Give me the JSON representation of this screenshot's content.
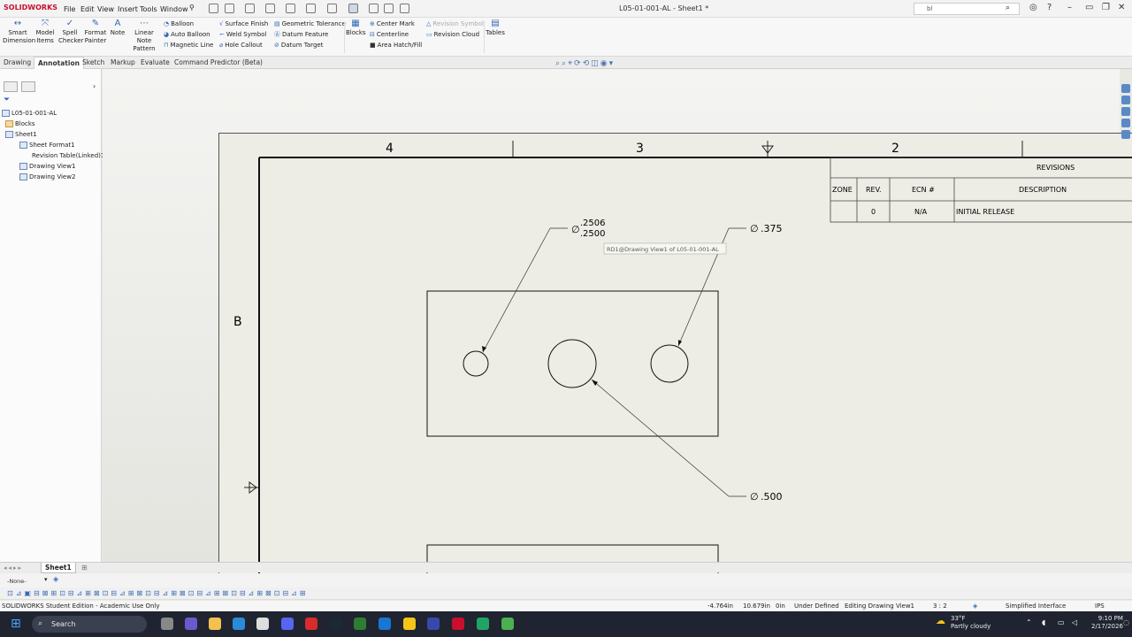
{
  "app": {
    "logo": "SOLIDWORKS",
    "document_title": "L05-01-001-AL - Sheet1 *",
    "search_value": "bl",
    "menus": [
      "File",
      "Edit",
      "View",
      "Insert",
      "Tools",
      "Window"
    ]
  },
  "ribbon": {
    "large_buttons": [
      {
        "label": "Smart Dimension",
        "icon": "smart-dimension-icon"
      },
      {
        "label": "Model Items",
        "icon": "model-items-icon"
      },
      {
        "label": "Spell Checker",
        "icon": "spell-checker-icon"
      },
      {
        "label": "Format Painter",
        "icon": "format-painter-icon"
      },
      {
        "label": "Note",
        "icon": "note-icon"
      },
      {
        "label": "Linear Note Pattern",
        "icon": "linear-note-pattern-icon"
      }
    ],
    "group1": [
      "Balloon",
      "Auto Balloon",
      "Magnetic Line"
    ],
    "group2": [
      "Surface Finish",
      "Weld Symbol",
      "Hole Callout"
    ],
    "group3": [
      "Geometric Tolerance",
      "Datum Feature",
      "Datum Target"
    ],
    "blocks": "Blocks",
    "group4": [
      "Center Mark",
      "Centerline",
      "Area Hatch/Fill"
    ],
    "group5": [
      "Revision Symbol",
      "Revision Cloud"
    ],
    "tables": "Tables"
  },
  "tabs": [
    "Drawing",
    "Annotation",
    "Sketch",
    "Markup",
    "Evaluate",
    "Command Predictor (Beta)"
  ],
  "active_tab": "Annotation",
  "tree": {
    "root": "L05-01-001-AL",
    "items": [
      "Blocks",
      "Sheet1",
      "Sheet Format1",
      "Revision Table(Linked)1",
      "Drawing View1",
      "Drawing View2"
    ]
  },
  "drawing": {
    "zones": [
      "4",
      "3",
      "2"
    ],
    "row_label": "B",
    "dims": {
      "upper_tol": "2506",
      "lower_tol": "2500",
      "right_dim": ".375",
      "bottom_dim": ".500",
      "diameter_symbol": "∅"
    },
    "tooltip": "RD1@Drawing View1 of L05-01-001-AL",
    "revisions": {
      "title": "REVISIONS",
      "headers": [
        "ZONE",
        "REV.",
        "ECN #",
        "DESCRIPTION"
      ],
      "rows": [
        [
          "",
          "0",
          "N/A",
          "INITIAL RELEASE"
        ]
      ]
    }
  },
  "sheet_tab": "Sheet1",
  "layer": "-None-",
  "status": {
    "edition": "SOLIDWORKS Student Edition - Academic Use Only",
    "x": "-4.764in",
    "y": "10.679in",
    "z": "0in",
    "state": "Under Defined",
    "editing": "Editing Drawing View1",
    "scale": "3 : 2",
    "interface": "Simplified Interface",
    "units": "IPS"
  },
  "taskbar": {
    "search": "Search",
    "temp": "33°F",
    "weather": "Partly cloudy",
    "time": "9:10 PM",
    "date": "2/17/2026"
  },
  "colors": {
    "accent": "#3468b5",
    "brand": "#c8102e",
    "sheet": "#edede6"
  }
}
